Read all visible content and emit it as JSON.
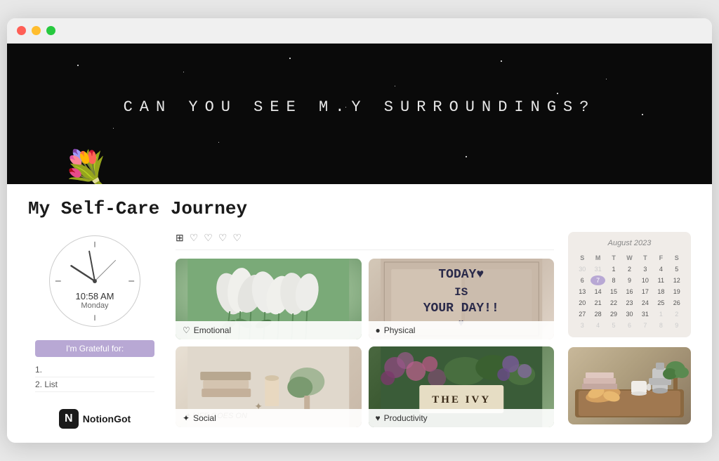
{
  "window": {
    "dots": [
      "red",
      "yellow",
      "green"
    ]
  },
  "hero": {
    "title": "CAN YOU SEE M.Y SURROUNDINGS?",
    "flower_emoji": "💐"
  },
  "page": {
    "title": "My Self-Care Journey"
  },
  "clock": {
    "time": "10:58 AM",
    "day": "Monday"
  },
  "toolbar": {
    "icons": [
      "⊞",
      "♡",
      "♡",
      "♡",
      "♡"
    ]
  },
  "grateful": {
    "header": "I'm Grateful for:",
    "items": [
      "1.",
      "2. List"
    ]
  },
  "gallery": {
    "cards": [
      {
        "label": "Emotional",
        "icon": "♡"
      },
      {
        "label": "Physical",
        "icon": "●"
      },
      {
        "label": "Social",
        "icon": "✦"
      },
      {
        "label": "Productivity",
        "icon": "♥"
      }
    ]
  },
  "calendar": {
    "title": "August 2023",
    "day_headers": [
      "S",
      "M",
      "T",
      "W",
      "T",
      "F",
      "S"
    ],
    "weeks": [
      [
        "30",
        "31",
        "1",
        "2",
        "3",
        "4",
        "5"
      ],
      [
        "6",
        "7",
        "8",
        "9",
        "10",
        "11",
        "12"
      ],
      [
        "13",
        "14",
        "15",
        "16",
        "17",
        "18",
        "19"
      ],
      [
        "20",
        "21",
        "22",
        "23",
        "24",
        "25",
        "26"
      ],
      [
        "27",
        "28",
        "29",
        "30",
        "31",
        "1",
        "2"
      ],
      [
        "3",
        "4",
        "5",
        "6",
        "7",
        "8",
        "9"
      ]
    ],
    "today_index": [
      1,
      1
    ]
  },
  "notion": {
    "logo": "N",
    "label": "NotionGot"
  }
}
